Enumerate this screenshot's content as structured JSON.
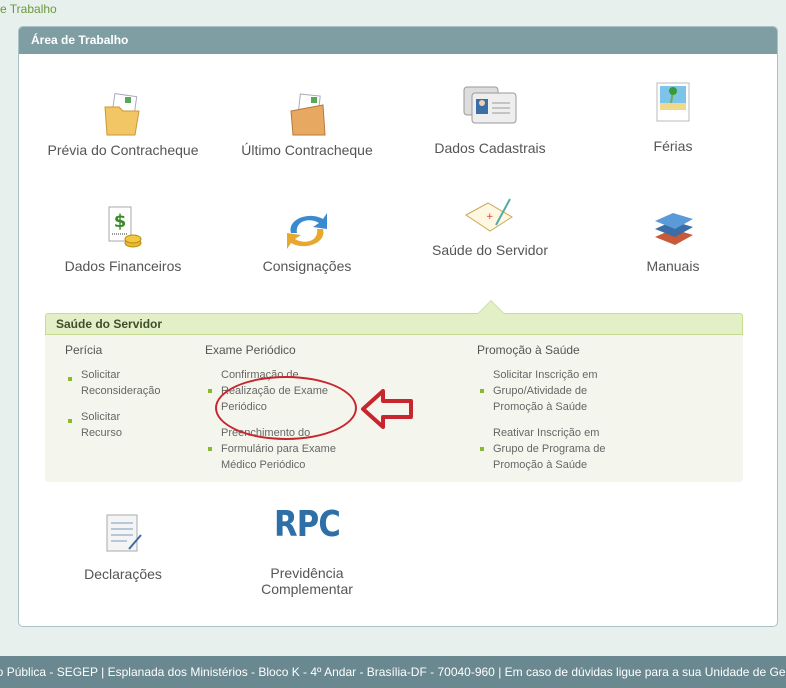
{
  "breadcrumb": "e Trabalho",
  "panel": {
    "title": "Área de Trabalho"
  },
  "tiles": {
    "previa": "Prévia do Contracheque",
    "ultimo": "Último Contracheque",
    "dados_cadastrais": "Dados Cadastrais",
    "ferias": "Férias",
    "dados_financeiros": "Dados Financeiros",
    "consignacoes": "Consignações",
    "saude": "Saúde do Servidor",
    "manuais": "Manuais",
    "declaracoes": "Declarações",
    "previdencia_line1": "Previdência",
    "previdencia_line2": "Complementar",
    "rpc_logo": "RPC"
  },
  "submenu": {
    "title": "Saúde do Servidor",
    "pericia": {
      "title": "Perícia",
      "items": [
        {
          "line1": "Solicitar",
          "line2": "Reconsideração"
        },
        {
          "line1": "Solicitar",
          "line2": "Recurso"
        }
      ]
    },
    "exame": {
      "title": "Exame Periódico",
      "items": [
        {
          "line1": "Confirmação de",
          "line2": "Realização de Exame",
          "line3": "Periódico"
        },
        {
          "line1": "Preenchimento do",
          "line2": "Formulário para Exame",
          "line3": "Médico Periódico"
        }
      ]
    },
    "promocao": {
      "title": "Promoção à Saúde",
      "items": [
        {
          "line1": "Solicitar Inscrição em",
          "line2": "Grupo/Atividade de",
          "line3": "Promoção à Saúde"
        },
        {
          "line1": "Reativar Inscrição em",
          "line2": "Grupo de Programa de",
          "line3": "Promoção à Saúde"
        }
      ]
    }
  },
  "footer": "estão Pública - SEGEP | Esplanada dos Ministérios - Bloco K - 4º Andar - Brasília-DF - 70040-960 | Em caso de dúvidas ligue para a sua Unidade de Ge",
  "colors": {
    "header": "#7f9ea3",
    "accent": "#8ab830",
    "annotation": "#c8262e",
    "rpc": "#2f6fa8"
  }
}
